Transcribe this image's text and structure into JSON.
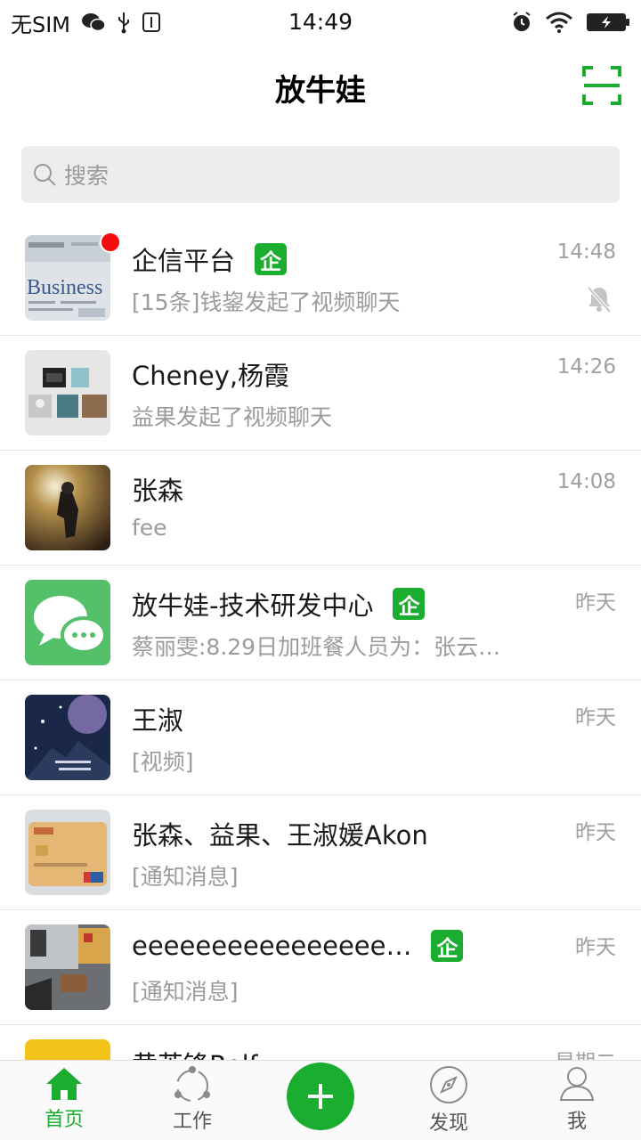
{
  "status_bar": {
    "carrier": "无SIM",
    "time": "14:49"
  },
  "header": {
    "title": "放牛娃"
  },
  "search": {
    "placeholder": "搜索"
  },
  "enterprise_badge": "企",
  "chats": [
    {
      "name": "企信平台",
      "preview": "[15条]钱鋆发起了视频聊天",
      "time": "14:48",
      "enterprise": true,
      "unread_dot": true,
      "muted": true
    },
    {
      "name": "Cheney,杨霞",
      "preview": "益果发起了视频聊天",
      "time": "14:26"
    },
    {
      "name": "张森",
      "preview": "fee",
      "time": "14:08"
    },
    {
      "name": "放牛娃-技术研发中心",
      "preview": "蔡丽雯:8.29日加班餐人员为：张云…",
      "time": "昨天",
      "enterprise": true
    },
    {
      "name": "王淑",
      "preview": "[视频]",
      "time": "昨天"
    },
    {
      "name": "张森、益果、王淑媛Akon",
      "preview": "[通知消息]",
      "time": "昨天"
    },
    {
      "name": "eeeeeeeeeeeeeeee…",
      "preview": "[通知消息]",
      "time": "昨天",
      "enterprise": true
    },
    {
      "name": "黄英锋Rolf",
      "preview": "",
      "time": "星期二"
    }
  ],
  "tabs": [
    {
      "label": "首页",
      "icon": "home-icon",
      "active": true
    },
    {
      "label": "工作",
      "icon": "work-icon"
    },
    {
      "label": "发现",
      "icon": "compass-icon"
    },
    {
      "label": "我",
      "icon": "person-icon"
    }
  ],
  "colors": {
    "accent": "#1aad2f",
    "unread": "#f50b0b",
    "search_bg": "#ededf0"
  }
}
